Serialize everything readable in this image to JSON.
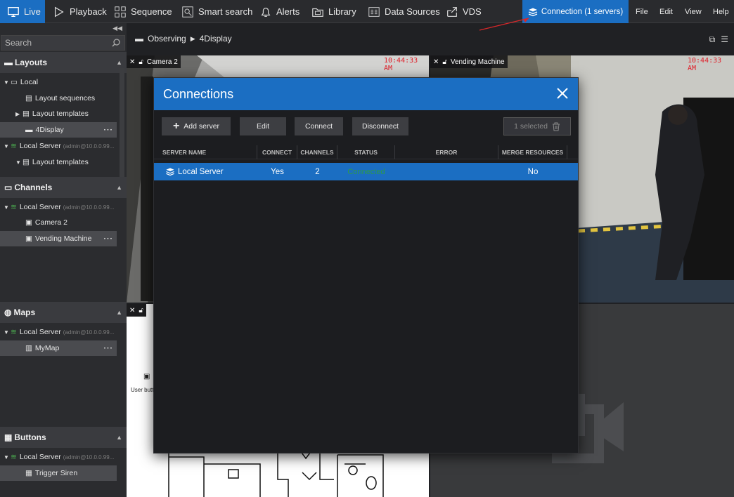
{
  "topbar": {
    "tabs": [
      {
        "label": "Live",
        "icon": "monitor-icon"
      },
      {
        "label": "Playback",
        "icon": "play-icon"
      },
      {
        "label": "Sequence",
        "icon": "sequence-icon"
      },
      {
        "label": "Smart search",
        "icon": "smart-search-icon"
      },
      {
        "label": "Alerts",
        "icon": "bell-icon"
      },
      {
        "label": "Library",
        "icon": "folder-icon"
      },
      {
        "label": "Data Sources",
        "icon": "data-sources-icon"
      },
      {
        "label": "VDS",
        "icon": "vds-icon"
      }
    ],
    "connection_label": "Connection (1 servers)",
    "menu": [
      "File",
      "Edit",
      "View",
      "Help"
    ]
  },
  "sidebar": {
    "search_placeholder": "Search",
    "layouts": {
      "title": "Layouts",
      "local": "Local",
      "layout_sequences": "Layout sequences",
      "layout_templates": "Layout templates",
      "display_4": "4Display",
      "local_server": "Local Server",
      "server_user": "(admin@10.0.0.99...",
      "layout_templates_2": "Layout templates"
    },
    "channels": {
      "title": "Channels",
      "local_server": "Local Server",
      "server_user": "(admin@10.0.0.99...",
      "camera2": "Camera 2",
      "vending": "Vending Machine"
    },
    "maps": {
      "title": "Maps",
      "local_server": "Local Server",
      "server_user": "(admin@10.0.0.99...",
      "mymap": "MyMap"
    },
    "buttons": {
      "title": "Buttons",
      "local_server": "Local Server",
      "server_user": "(admin@10.0.0.99...",
      "trigger_siren": "Trigger Siren"
    }
  },
  "breadcrumb": {
    "root": "Observing",
    "leaf": "4Display"
  },
  "tiles": {
    "camera2_title": "Camera 2",
    "camera2_time": "10:44:33 AM",
    "vending_title": "Vending Machine",
    "vending_time": "10:44:33 AM",
    "map_user_button": "User butt"
  },
  "dialog": {
    "title": "Connections",
    "add_server": "Add server",
    "edit": "Edit",
    "connect": "Connect",
    "disconnect": "Disconnect",
    "selected": "1 selected",
    "columns": [
      "SERVER NAME",
      "CONNECT",
      "CHANNELS",
      "STATUS",
      "ERROR",
      "MERGE RESOURCES"
    ],
    "rows": [
      {
        "server_name": "Local Server",
        "connect": "Yes",
        "channels": "2",
        "status": "Connected",
        "error": "",
        "merge": "No"
      }
    ]
  },
  "colors": {
    "accent": "#1b6ec2",
    "timestamp": "#e0202a",
    "status_connected": "#2e9a4a"
  }
}
